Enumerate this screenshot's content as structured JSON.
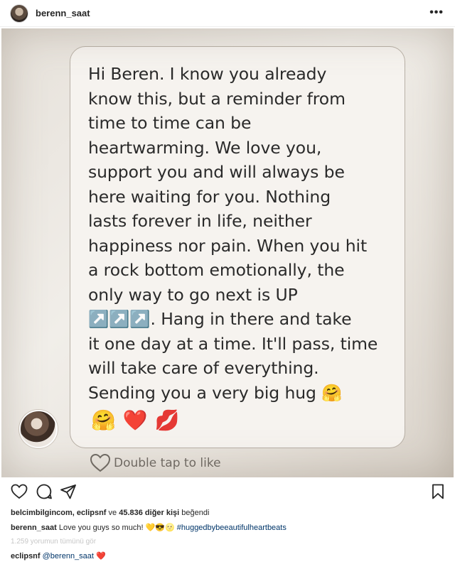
{
  "post": {
    "username": "berenn_saat",
    "more_label": "•••"
  },
  "photo": {
    "message": "Hi Beren. I know you already\nknow this, but a reminder from\ntime to time can be\nheartwarming. We love you,\nsupport you and will always be\nhere waiting for you. Nothing\nlasts forever in life, neither\nhappiness nor pain. When you hit\na rock bottom emotionally, the\nonly way to go next is UP\n↗️↗️↗️. Hang in there and take\nit one day at a time. It'll pass, time\nwill take care of everything.\nSending you a very big hug 🤗",
    "emojis": [
      "🤗",
      "❤️",
      "💋"
    ],
    "double_tap_label": "Double tap to like"
  },
  "likes": {
    "users": "belcimbilgincom, eclipsnf",
    "connector": "ve",
    "others": "45.836 diğer kişi",
    "suffix": "beğendi"
  },
  "caption": {
    "username": "berenn_saat",
    "text": "Love you guys so much!",
    "emojis": "💛😎🌝",
    "hashtag": "#huggedbybeeautifulheartbeats"
  },
  "view_all_comments": "1.259 yorumun tümünü gör",
  "comment": {
    "username": "eclipsnf",
    "mention": "@berenn_saat",
    "emoji": "❤️"
  },
  "icons": [
    "heart-icon",
    "comment-icon",
    "share-icon",
    "bookmark-icon",
    "more-icon"
  ]
}
